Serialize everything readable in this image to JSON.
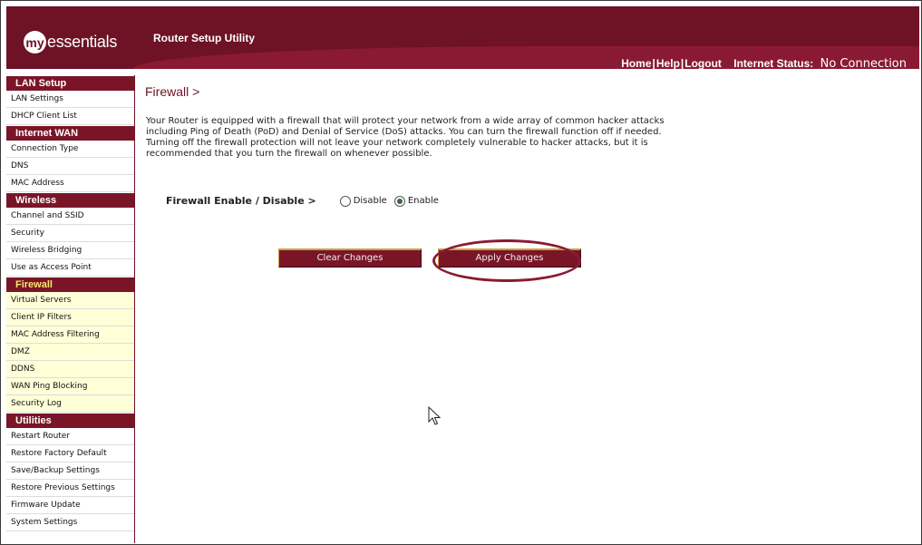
{
  "header": {
    "logo_prefix": "my",
    "logo_word": "essentials",
    "app_title": "Router Setup Utility",
    "nav": {
      "home": "Home",
      "help": "Help",
      "logout": "Logout",
      "separator": "|"
    },
    "status_label": "Internet Status:",
    "status_value": "No Connection"
  },
  "sidebar": {
    "sections": [
      {
        "title": "LAN Setup",
        "items": [
          "LAN Settings",
          "DHCP Client List"
        ]
      },
      {
        "title": "Internet WAN",
        "items": [
          "Connection Type",
          "DNS",
          "MAC Address"
        ]
      },
      {
        "title": "Wireless",
        "items": [
          "Channel and SSID",
          "Security",
          "Wireless Bridging",
          "Use as Access Point"
        ]
      },
      {
        "title": "Firewall",
        "items": [
          "Virtual Servers",
          "Client IP Filters",
          "MAC Address Filtering",
          "DMZ",
          "DDNS",
          "WAN Ping Blocking",
          "Security Log"
        ]
      },
      {
        "title": "Utilities",
        "items": [
          "Restart Router",
          "Restore Factory Default",
          "Save/Backup Settings",
          "Restore Previous Settings",
          "Firmware Update",
          "System Settings"
        ]
      }
    ]
  },
  "main": {
    "title": "Firewall >",
    "description": "Your Router is equipped with a firewall that will protect your network from a wide array of common hacker attacks including Ping of Death (PoD) and Denial of Service (DoS) attacks. You can turn the firewall function off if needed. Turning off the firewall protection will not leave your network completely vulnerable to hacker attacks, but it is recommended that you turn the firewall on whenever possible.",
    "firewall_label": "Firewall Enable / Disable >",
    "option_disable": "Disable",
    "option_enable": "Enable",
    "selected": "Enable",
    "clear_button": "Clear Changes",
    "apply_button": "Apply Changes"
  },
  "colors": {
    "brand": "#6e1226",
    "section_header": "#7a1528",
    "active_section_text": "#f5e96a",
    "highlight_bg": "#ffffd8"
  }
}
